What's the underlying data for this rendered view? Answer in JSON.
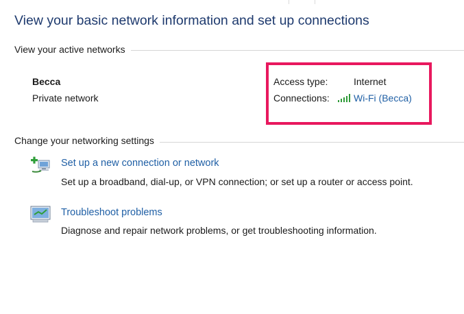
{
  "page_title": "View your basic network information and set up connections",
  "active_networks": {
    "heading": "View your active networks",
    "network_name": "Becca",
    "network_type": "Private network",
    "access_type_label": "Access type:",
    "access_type_value": "Internet",
    "connections_label": "Connections:",
    "connection_link": "Wi-Fi (Becca)",
    "connection_icon": "wifi-signal-icon"
  },
  "settings": {
    "heading": "Change your networking settings",
    "tasks": [
      {
        "title": "Set up a new connection or network",
        "description": "Set up a broadband, dial-up, or VPN connection; or set up a router or access point.",
        "icon": "new-connection-icon"
      },
      {
        "title": "Troubleshoot problems",
        "description": "Diagnose and repair network problems, or get troubleshooting information.",
        "icon": "troubleshoot-icon"
      }
    ]
  },
  "colors": {
    "title": "#1e3a6e",
    "link": "#1f5fa5",
    "highlight": "#e8185e",
    "signal": "#2e9a37"
  }
}
